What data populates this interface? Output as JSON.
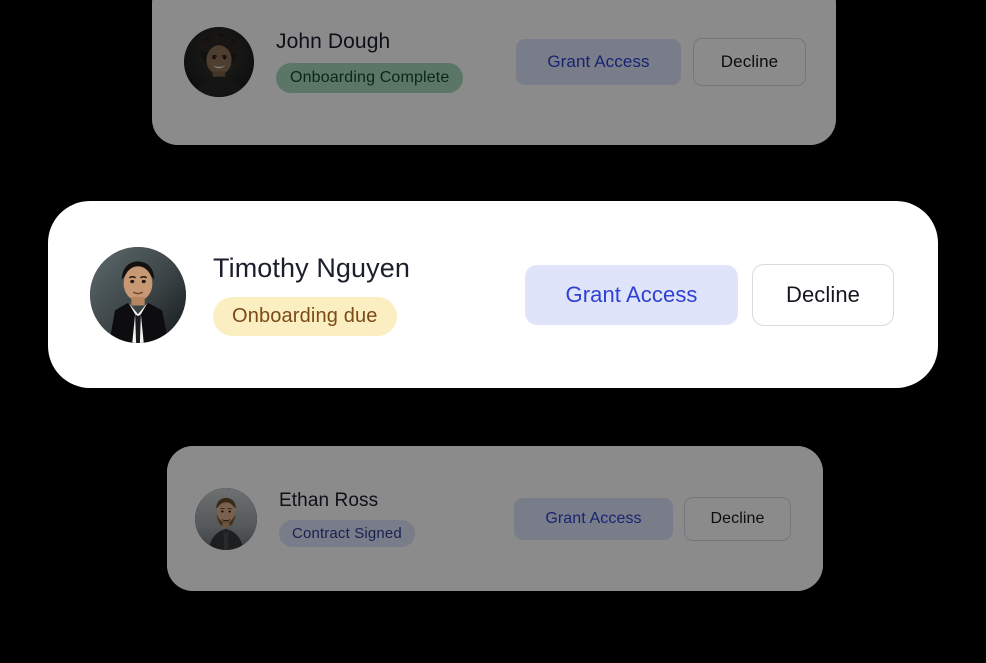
{
  "background_color": "#000000",
  "theme": {
    "card_background": "#ffffff",
    "name_color": "#1b1e2b",
    "grant_bg": "#dfe4fb",
    "grant_text": "#2f40d4",
    "decline_bg": "#ffffff",
    "decline_text": "#16181f",
    "decline_border": "#d8dade",
    "badge_green_bg": "#a8d8bd",
    "badge_green_text": "#10492c",
    "badge_yellow_bg": "#fbeec1",
    "badge_yellow_text": "#7b4a16",
    "badge_blue_bg": "#dfe3fb",
    "badge_blue_text": "#2f3f93",
    "dim_overlay": "rgba(0,0,0,0.455)"
  },
  "cards": [
    {
      "id": "john-dough",
      "name": "John Dough",
      "status_label": "Onboarding Complete",
      "status_variant": "green",
      "grant_label": "Grant Access",
      "decline_label": "Decline",
      "avatar_name": "avatar-john-dough",
      "dimmed": true,
      "focused": false
    },
    {
      "id": "timothy-nguyen",
      "name": "Timothy Nguyen",
      "status_label": "Onboarding due",
      "status_variant": "yellow",
      "grant_label": "Grant Access",
      "decline_label": "Decline",
      "avatar_name": "avatar-timothy-nguyen",
      "dimmed": false,
      "focused": true
    },
    {
      "id": "ethan-ross",
      "name": "Ethan Ross",
      "status_label": "Contract Signed",
      "status_variant": "blue",
      "grant_label": "Grant Access",
      "decline_label": "Decline",
      "avatar_name": "avatar-ethan-ross",
      "dimmed": true,
      "focused": false
    }
  ]
}
